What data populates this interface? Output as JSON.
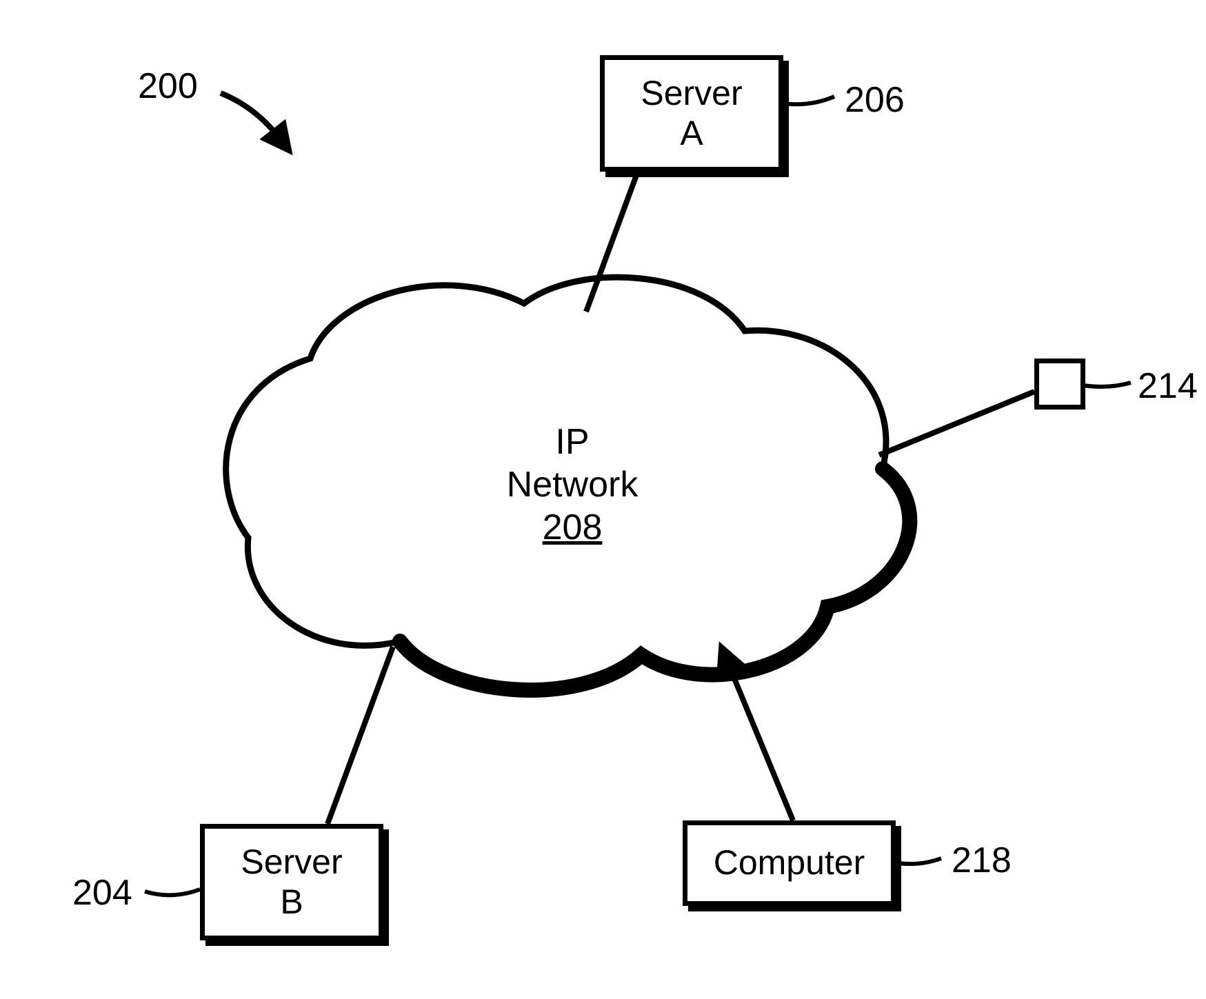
{
  "figure": {
    "ref_system": "200",
    "cloud": {
      "line1": "IP",
      "line2": "Network",
      "ref": "208"
    },
    "server_a": {
      "label_line1": "Server",
      "label_line2": "A",
      "ref": "206"
    },
    "server_b": {
      "label_line1": "Server",
      "label_line2": "B",
      "ref": "204"
    },
    "computer": {
      "label": "Computer",
      "ref": "218"
    },
    "node_small": {
      "ref": "214"
    }
  }
}
